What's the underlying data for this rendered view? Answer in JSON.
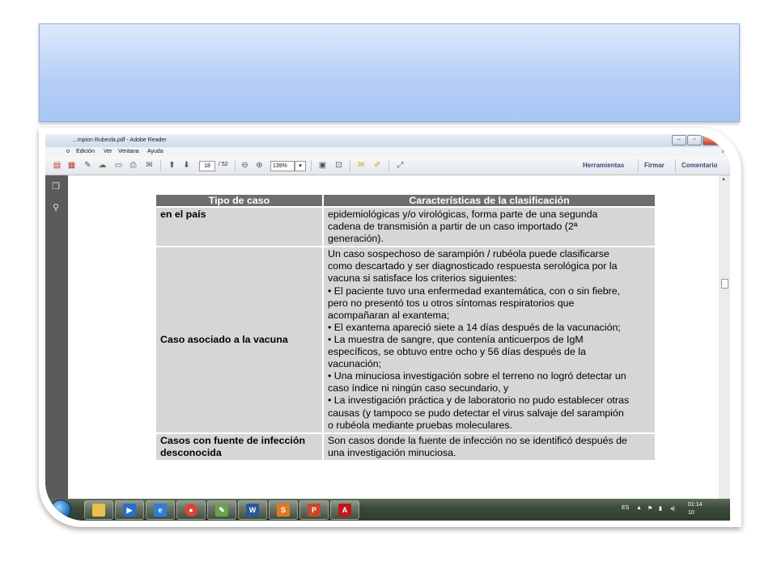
{
  "window": {
    "title": "...mpion Rubeola.pdf - Adobe Reader",
    "title_right_blurred": "..."
  },
  "menu": {
    "items": [
      "o",
      "Edición",
      "Ver",
      "Ventana",
      "Ayuda"
    ]
  },
  "toolbar": {
    "page_current": "18",
    "page_total": "/ 52",
    "zoom": "139%",
    "zoom_arrow": "▾",
    "herramientas": "Herramientas",
    "firmar": "Firmar",
    "comentario": "Comentario"
  },
  "table": {
    "headers": [
      "Tipo de caso",
      "Características de la clasificación"
    ],
    "rows": [
      {
        "type": [
          "en el país"
        ],
        "lines": [
          "epidemiológicas y/o virológicas, forma parte de una segunda",
          "cadena de transmisión a partir de un caso importado (2ª",
          "generación)."
        ]
      },
      {
        "type": [
          "Caso asociado a la vacuna"
        ],
        "lines": [
          " Un caso sospechoso de sarampión / rubéola puede clasificarse",
          "como descartado y ser diagnosticado respuesta serológica por la",
          "vacuna si satisface los  criterios siguientes:",
          "• El paciente tuvo una enfermedad exantemática, con o sin fiebre,",
          "pero no presentó tos u otros síntomas respiratorios que",
          "acompañaran al exantema;",
          "• El exantema apareció siete a 14 días después de la vacunación;",
          "• La muestra de sangre, que contenía anticuerpos de IgM",
          "específicos, se obtuvo entre ocho y 56 días después de la",
          "vacunación;",
          "• Una minuciosa investigación sobre el terreno no logró detectar un",
          "caso índice ni ningún caso secundario, y",
          "• La investigación práctica y de laboratorio no pudo establecer otras",
          "causas (y tampoco se pudo detectar el virus salvaje del sarampión",
          "o rubéola mediante pruebas moleculares."
        ]
      },
      {
        "type": [
          "Casos con fuente de infección",
          "desconocida"
        ],
        "lines": [
          "Son casos donde la fuente de infección no se identificó después de",
          "una investigación minuciosa."
        ]
      }
    ]
  },
  "taskbar": {
    "apps": [
      {
        "name": "explorer",
        "glyph": "",
        "color": "#e8c14a"
      },
      {
        "name": "media-player",
        "glyph": "▶",
        "color": "#2a6fc4"
      },
      {
        "name": "internet-explorer",
        "glyph": "e",
        "color": "#2f7fd6"
      },
      {
        "name": "chrome",
        "glyph": "●",
        "color": "#d8453b"
      },
      {
        "name": "paint",
        "glyph": "✎",
        "color": "#6aa04a"
      },
      {
        "name": "word",
        "glyph": "W",
        "color": "#2b579a"
      },
      {
        "name": "slide",
        "glyph": "S",
        "color": "#e07a1f"
      },
      {
        "name": "powerpoint",
        "glyph": "P",
        "color": "#c8472b"
      },
      {
        "name": "adobe-reader",
        "glyph": "A",
        "color": "#c01818"
      }
    ],
    "lang": "ES",
    "time": "01:14",
    "date": "10"
  }
}
